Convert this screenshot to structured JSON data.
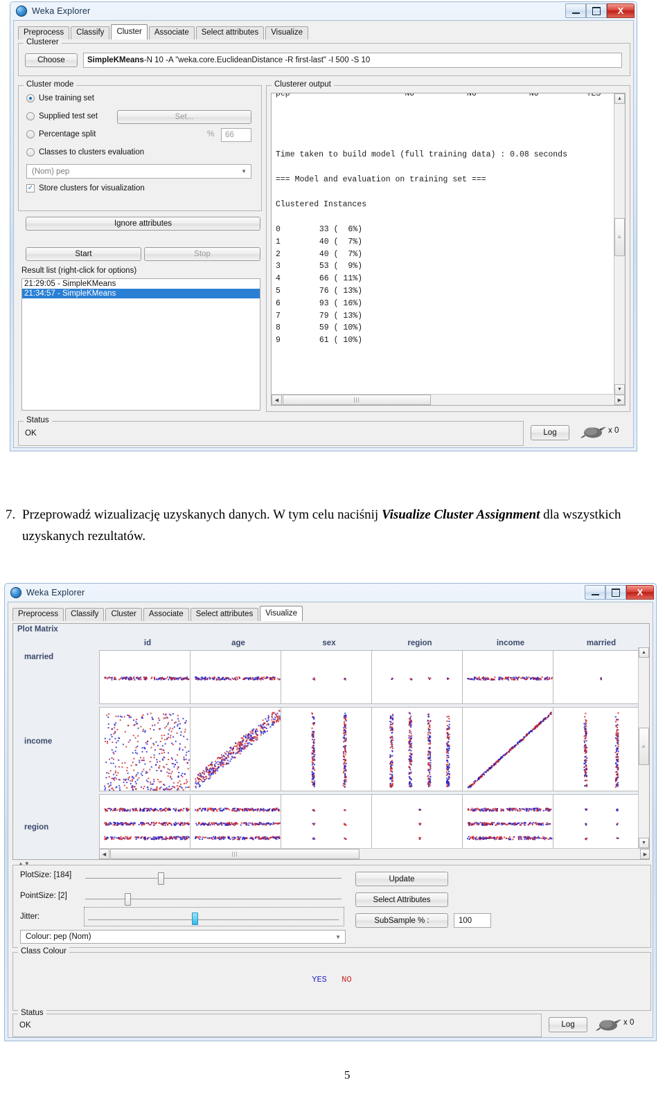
{
  "page": {
    "number": "5"
  },
  "document_text": {
    "item_number": "7.",
    "part1": "Przeprowadź wizualizację uzyskanych danych. W tym celu naciśnij ",
    "emphasis1": "Visualize Cluster Assignment",
    "part2": " dla wszystkich uzyskanych rezultatów."
  },
  "window_cluster": {
    "title": "Weka Explorer",
    "icon": "weka-bird-icon",
    "buttons": {
      "minimize": "–",
      "maximize": "□",
      "close": "X"
    },
    "tabs": [
      {
        "label": "Preprocess",
        "active": false
      },
      {
        "label": "Classify",
        "active": false
      },
      {
        "label": "Cluster",
        "active": true
      },
      {
        "label": "Associate",
        "active": false
      },
      {
        "label": "Select attributes",
        "active": false
      },
      {
        "label": "Visualize",
        "active": false
      }
    ],
    "clusterer": {
      "group_label": "Clusterer",
      "choose_button": "Choose",
      "scheme_name": "SimpleKMeans",
      "scheme_options": " -N 10 -A \"weka.core.EuclideanDistance -R first-last\" -I 500 -S 10"
    },
    "cluster_mode": {
      "group_label": "Cluster mode",
      "options": [
        {
          "label": "Use training set",
          "selected": true
        },
        {
          "label": "Supplied test set",
          "selected": false
        },
        {
          "label": "Percentage split",
          "selected": false
        },
        {
          "label": "Classes to clusters evaluation",
          "selected": false
        }
      ],
      "set_button": "Set...",
      "percent_symbol": "%",
      "percent_value": "66",
      "class_combo_value": "(Nom) pep",
      "store_clusters_label": "Store clusters for visualization",
      "store_clusters_checked": true,
      "check_glyph": "✓"
    },
    "ignore_attributes_button": "Ignore attributes",
    "start_button": "Start",
    "stop_button": "Stop",
    "result_list": {
      "label": "Result list (right-click for options)",
      "items": [
        {
          "text": "21:29:05 - SimpleKMeans",
          "selected": false
        },
        {
          "text": "21:34:57 - SimpleKMeans",
          "selected": true
        }
      ]
    },
    "output": {
      "group_label": "Clusterer output",
      "header_line": "pep                        NO           NO           NO          YES",
      "lines": [
        "",
        "",
        "Time taken to build model (full training data) : 0.08 seconds",
        "",
        "=== Model and evaluation on training set ===",
        "",
        "Clustered Instances",
        ""
      ],
      "clustered_instances": [
        {
          "cluster": "0",
          "count": "33",
          "percent": "(  6%)"
        },
        {
          "cluster": "1",
          "count": "40",
          "percent": "(  7%)"
        },
        {
          "cluster": "2",
          "count": "40",
          "percent": "(  7%)"
        },
        {
          "cluster": "3",
          "count": "53",
          "percent": "(  9%)"
        },
        {
          "cluster": "4",
          "count": "66",
          "percent": "( 11%)"
        },
        {
          "cluster": "5",
          "count": "76",
          "percent": "( 13%)"
        },
        {
          "cluster": "6",
          "count": "93",
          "percent": "( 16%)"
        },
        {
          "cluster": "7",
          "count": "79",
          "percent": "( 13%)"
        },
        {
          "cluster": "8",
          "count": "59",
          "percent": "( 10%)"
        },
        {
          "cluster": "9",
          "count": "61",
          "percent": "( 10%)"
        }
      ]
    },
    "status": {
      "group_label": "Status",
      "text": "OK",
      "log_button": "Log",
      "task_count": "x 0"
    }
  },
  "window_visualize": {
    "title": "Weka Explorer",
    "icon": "weka-bird-icon",
    "buttons": {
      "minimize": "–",
      "maximize": "□",
      "close": "X"
    },
    "tabs": [
      {
        "label": "Preprocess",
        "active": false
      },
      {
        "label": "Classify",
        "active": false
      },
      {
        "label": "Cluster",
        "active": false
      },
      {
        "label": "Associate",
        "active": false
      },
      {
        "label": "Select attributes",
        "active": false
      },
      {
        "label": "Visualize",
        "active": true
      }
    ],
    "plot_matrix": {
      "label": "Plot Matrix",
      "columns": [
        "id",
        "age",
        "sex",
        "region",
        "income",
        "married"
      ],
      "rows": [
        "married",
        "income",
        "region"
      ]
    },
    "controls": {
      "plotsize_label": "PlotSize: [184]",
      "pointsize_label": "PointSize: [2]",
      "jitter_label": "Jitter:",
      "colour_combo": "Colour: pep (Nom)",
      "update_button": "Update",
      "select_attributes_button": "Select Attributes",
      "subsample_button": "SubSample % :",
      "subsample_value": "100"
    },
    "class_colour": {
      "group_label": "Class Colour",
      "values": [
        {
          "label": "YES",
          "color": "#2222cc"
        },
        {
          "label": "NO",
          "color": "#cc2222"
        }
      ]
    },
    "status": {
      "group_label": "Status",
      "text": "OK",
      "log_button": "Log",
      "task_count": "x 0"
    }
  },
  "chart_data": {
    "type": "scatter",
    "title": "Plot Matrix",
    "xlabel": "",
    "ylabel": "",
    "legend_position": "bottom",
    "grid": false,
    "colour_attribute": "pep (Nom)",
    "classes": [
      {
        "name": "YES",
        "color": "#2222cc"
      },
      {
        "name": "NO",
        "color": "#cc2222"
      }
    ],
    "columns": [
      "id",
      "age",
      "sex",
      "region",
      "income",
      "married"
    ],
    "rows": [
      "married",
      "income",
      "region"
    ],
    "cells": [
      {
        "row": "married",
        "col": "id",
        "pattern": "horizontal-band",
        "bands": 1
      },
      {
        "row": "married",
        "col": "age",
        "pattern": "horizontal-band",
        "bands": 1
      },
      {
        "row": "married",
        "col": "sex",
        "pattern": "discrete-points",
        "bands": 1,
        "levels": 2
      },
      {
        "row": "married",
        "col": "region",
        "pattern": "discrete-points",
        "bands": 1,
        "levels": 4
      },
      {
        "row": "married",
        "col": "income",
        "pattern": "horizontal-band",
        "bands": 1
      },
      {
        "row": "married",
        "col": "married",
        "pattern": "discrete-points",
        "bands": 1,
        "levels": 1
      },
      {
        "row": "income",
        "col": "id",
        "pattern": "cloud"
      },
      {
        "row": "income",
        "col": "age",
        "pattern": "diagonal-cloud"
      },
      {
        "row": "income",
        "col": "sex",
        "pattern": "vertical-strips",
        "levels": 2
      },
      {
        "row": "income",
        "col": "region",
        "pattern": "vertical-strips",
        "levels": 4
      },
      {
        "row": "income",
        "col": "income",
        "pattern": "diagonal-line"
      },
      {
        "row": "income",
        "col": "married",
        "pattern": "vertical-strips",
        "levels": 2
      },
      {
        "row": "region",
        "col": "id",
        "pattern": "horizontal-band",
        "bands": 3
      },
      {
        "row": "region",
        "col": "age",
        "pattern": "horizontal-band",
        "bands": 3
      },
      {
        "row": "region",
        "col": "sex",
        "pattern": "discrete-points",
        "bands": 3,
        "levels": 2
      },
      {
        "row": "region",
        "col": "region",
        "pattern": "discrete-points",
        "bands": 3,
        "levels": 1
      },
      {
        "row": "region",
        "col": "income",
        "pattern": "horizontal-band",
        "bands": 3
      },
      {
        "row": "region",
        "col": "married",
        "pattern": "discrete-points",
        "bands": 3,
        "levels": 2
      }
    ],
    "subsample_percent": 100,
    "point_size": 2,
    "plot_size": 184
  }
}
